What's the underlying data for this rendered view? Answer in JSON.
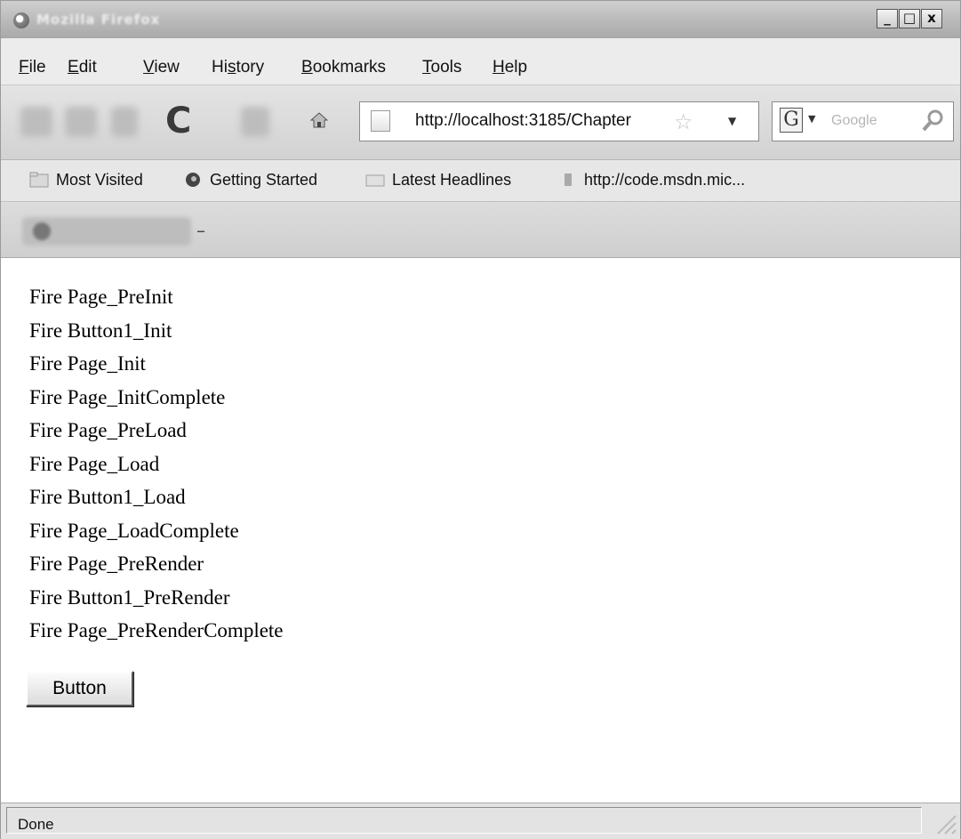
{
  "window": {
    "title": "Mozilla Firefox",
    "controls": {
      "minimize": "_",
      "maximize": "□",
      "close": "x"
    }
  },
  "menu": {
    "items": [
      {
        "label": "File",
        "mnemonic": "F"
      },
      {
        "label": "Edit",
        "mnemonic": "E"
      },
      {
        "label": "View",
        "mnemonic": "V"
      },
      {
        "label": "History",
        "mnemonic": "s"
      },
      {
        "label": "Bookmarks",
        "mnemonic": "B"
      },
      {
        "label": "Tools",
        "mnemonic": "T"
      },
      {
        "label": "Help",
        "mnemonic": "H"
      }
    ]
  },
  "navigation": {
    "address": "http://localhost:3185/Chapter",
    "search_placeholder": "Google",
    "icons": [
      "back-icon",
      "forward-icon",
      "reload-icon",
      "stop-icon",
      "home-icon",
      "page-icon",
      "star-icon",
      "google-icon",
      "magnifier-icon"
    ]
  },
  "bookmarks": [
    {
      "label": "Most Visited",
      "icon": "folder-icon"
    },
    {
      "label": "Getting Started",
      "icon": "firefox-icon"
    },
    {
      "label": "Latest Headlines",
      "icon": "rss-folder-icon"
    },
    {
      "label": "http://code.msdn.mic...",
      "icon": "page-icon"
    }
  ],
  "page": {
    "log_lines": [
      "Fire Page_PreInit",
      "Fire Button1_Init",
      "Fire Page_Init",
      "Fire Page_InitComplete",
      "Fire Page_PreLoad",
      "Fire Page_Load",
      "Fire Button1_Load",
      "Fire Page_LoadComplete",
      "Fire Page_PreRender",
      "Fire Button1_PreRender",
      "Fire Page_PreRenderComplete"
    ],
    "button_label": "Button"
  },
  "status": {
    "text": "Done"
  },
  "colors": {
    "chrome": "#d6d6d6",
    "content_bg": "#ffffff",
    "text": "#000000"
  }
}
